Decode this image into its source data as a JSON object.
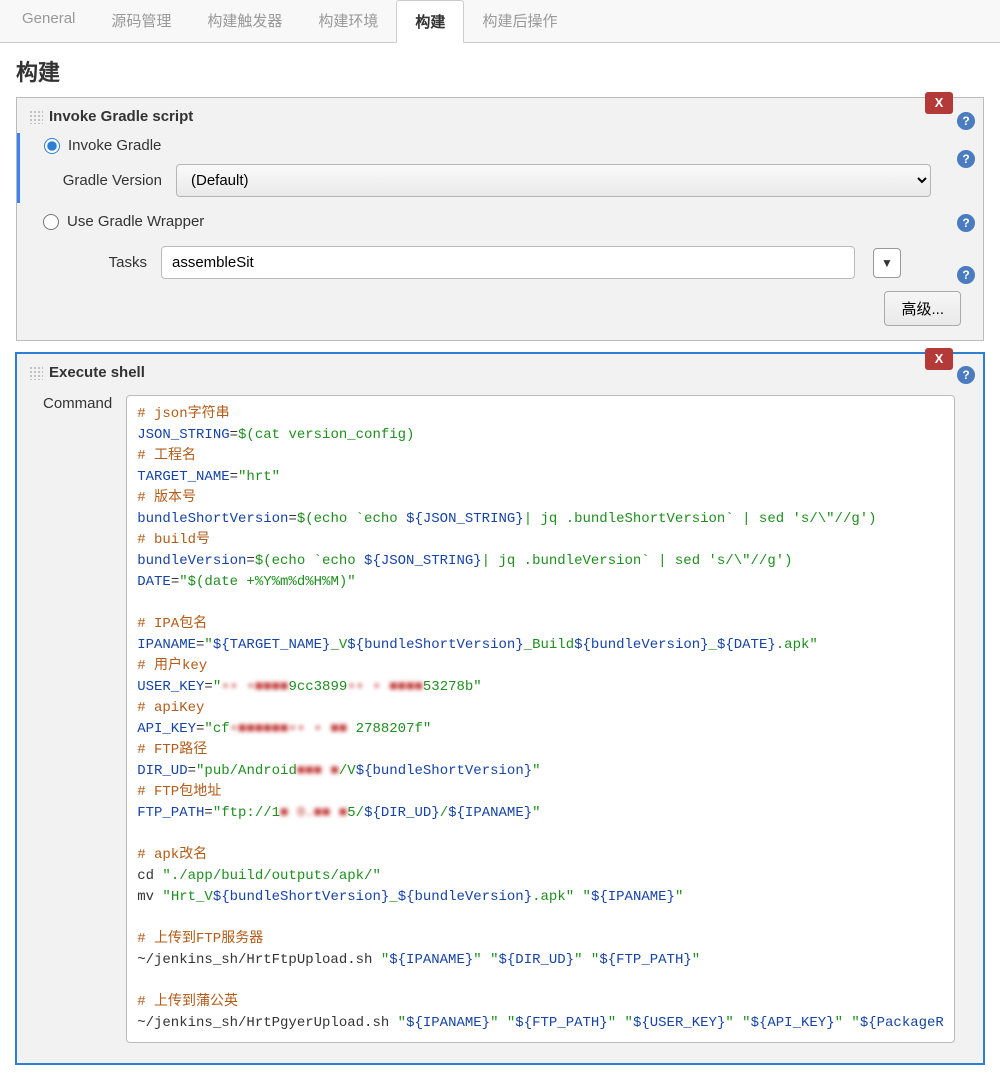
{
  "tabs": [
    {
      "label": "General"
    },
    {
      "label": "源码管理"
    },
    {
      "label": "构建触发器"
    },
    {
      "label": "构建环境"
    },
    {
      "label": "构建",
      "active": true
    },
    {
      "label": "构建后操作"
    }
  ],
  "page": {
    "title": "构建"
  },
  "gradle": {
    "panel_title": "Invoke Gradle script",
    "close_label": "X",
    "radio_invoke": "Invoke Gradle",
    "radio_wrapper": "Use Gradle Wrapper",
    "version_label": "Gradle Version",
    "version_value": "(Default)",
    "tasks_label": "Tasks",
    "tasks_value": "assembleSit",
    "expand_glyph": "▼",
    "advanced_label": "高级..."
  },
  "shell": {
    "panel_title": "Execute shell",
    "close_label": "X",
    "command_label": "Command",
    "lines": {
      "c1": "# json字符串",
      "l2a": "JSON_STRING",
      "l2b": "=",
      "l2c": "$(cat version_config)",
      "c3": "# 工程名",
      "l4a": "TARGET_NAME",
      "l4b": "=",
      "l4c": "\"hrt\"",
      "c5": "# 版本号",
      "l6a": "bundleShortVersion",
      "l6b": "=",
      "l6c": "$(echo `echo ",
      "l6d": "${JSON_STRING}",
      "l6e": "| jq .bundleShortVersion` | sed 's/\\\"//g')",
      "c7": "# build号",
      "l8a": "bundleVersion",
      "l8b": "=",
      "l8c": "$(echo `echo ",
      "l8d": "${JSON_STRING}",
      "l8e": "| jq .bundleVersion` | sed 's/\\\"//g')",
      "l9a": "DATE",
      "l9b": "=",
      "l9c": "\"$(date +%Y%m%d%H%M)\"",
      "c11": "# IPA包名",
      "l12a": "IPANAME",
      "l12b": "=",
      "l12c": "\"",
      "l12d": "${TARGET_NAME}",
      "l12e": "_V",
      "l12f": "${bundleShortVersion}",
      "l12g": "_Build",
      "l12h": "${bundleVersion}",
      "l12i": "_",
      "l12j": "${DATE}",
      "l12k": ".apk\"",
      "c13": "# 用户key",
      "l14a": "USER_KEY",
      "l14b": "=",
      "l14c": "\"",
      "l14d": "•• •■■■■",
      "l14e": "9cc3899",
      "l14f": "•• • ■■■■",
      "l14g": "53278b\"",
      "c15": "# apiKey",
      "l16a": "API_KEY",
      "l16b": "=",
      "l16c": "\"cf",
      "l16d": "•■■■■■■•• • ■■",
      "l16e": " 2788207f\"",
      "c17": "# FTP路径",
      "l18a": "DIR_UD",
      "l18b": "=",
      "l18c": "\"pub/Android",
      "l18d": "■■■ ■",
      "l18e": "/V",
      "l18f": "${bundleShortVersion}",
      "l18g": "\"",
      "c19": "# FTP包地址",
      "l20a": "FTP_PATH",
      "l20b": "=",
      "l20c": "\"ftp://1",
      "l20d": "■ 0.■■ ■",
      "l20e": "5/",
      "l20f": "${DIR_UD}",
      "l20g": "/",
      "l20h": "${IPANAME}",
      "l20i": "\"",
      "c22": "# apk改名",
      "l23a": "cd ",
      "l23b": "\"./app/build/outputs/apk/\"",
      "l24a": "mv ",
      "l24b": "\"Hrt_V",
      "l24c": "${bundleShortVersion}",
      "l24d": "_",
      "l24e": "${bundleVersion}",
      "l24f": ".apk\"",
      "l24g": " ",
      "l24h": "\"",
      "l24i": "${IPANAME}",
      "l24j": "\"",
      "c26": "# 上传到FTP服务器",
      "l27a": "~/jenkins_sh/HrtFtpUpload.sh ",
      "l27b": "\"",
      "l27c": "${IPANAME}",
      "l27d": "\" \"",
      "l27e": "${DIR_UD}",
      "l27f": "\" \"",
      "l27g": "${FTP_PATH}",
      "l27h": "\"",
      "c29": "# 上传到蒲公英",
      "l30a": "~/jenkins_sh/HrtPgyerUpload.sh ",
      "l30b": "\"",
      "l30c": "${IPANAME}",
      "l30d": "\" \"",
      "l30e": "${FTP_PATH}",
      "l30f": "\" \"",
      "l30g": "${USER_KEY}",
      "l30h": "\" \"",
      "l30i": "${API_KEY}",
      "l30j": "\" \"",
      "l30k": "${PackageR"
    }
  },
  "icons": {
    "help": "?"
  }
}
